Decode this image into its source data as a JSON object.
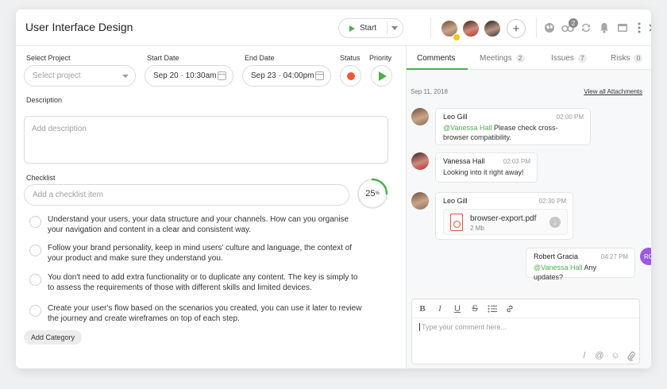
{
  "header": {
    "title": "User Interface Design",
    "start_label": "Start",
    "notification_count": "2"
  },
  "form": {
    "project_label": "Select Project",
    "project_placeholder": "Select project",
    "start_date_label": "Start Date",
    "start_date_value": "Sep 20 · 10:30am",
    "end_date_label": "End Date",
    "end_date_value": "Sep 23 · 04:00pm",
    "status_label": "Status",
    "priority_label": "Priority",
    "description_label": "Description",
    "description_placeholder": "Add description",
    "checklist_label": "Checklist",
    "checklist_placeholder": "Add a checklist item",
    "progress_percent": 25,
    "progress_text": "25",
    "progress_unit": "%",
    "add_category_label": "Add Category"
  },
  "checklist_items": [
    {
      "text": "Understand your users, your data structure and your channels. How can you organise your navigation and content in a clear and consistent way."
    },
    {
      "text": "Follow your brand personality, keep in mind users' culture and language, the context of your product and make sure they understand you."
    },
    {
      "text": "You don't need to add extra functionality or to duplicate any content. The key is simply to to assess the requirements of those with different skills and limited devices."
    },
    {
      "text": "Create your user's flow based on the scenarios you created, you can use it later to review the journey and create wireframes on top of each step."
    }
  ],
  "tabs": [
    {
      "label": "Comments",
      "count": ""
    },
    {
      "label": "Meetings",
      "count": "2"
    },
    {
      "label": "Issues",
      "count": "7"
    },
    {
      "label": "Risks",
      "count": "0"
    }
  ],
  "comments": {
    "date": "Sep 11, 2018",
    "view_all": "View all Attachments",
    "messages": [
      {
        "author": "Leo Gill",
        "time": "02:00 PM",
        "mention": "@Vanessa Hall",
        "text": " Please check cross-browser compatibility."
      },
      {
        "author": "Vanessa Hall",
        "time": "02:03 PM",
        "text": "Looking into it right away!"
      },
      {
        "author": "Leo Gill",
        "time": "02:30 PM",
        "file_name": "browser-export.pdf",
        "file_size": "2 Mb"
      },
      {
        "author": "Robert Gracia",
        "time": "04:27 PM",
        "mention": "@Vanessa Hall",
        "text": " Any updates?",
        "initials": "RG"
      }
    ],
    "input_placeholder": "Type your comment here..."
  },
  "colors": {
    "accent": "#4caf50",
    "status": "#f0563a",
    "avatar_rg": "#9b59e0"
  }
}
